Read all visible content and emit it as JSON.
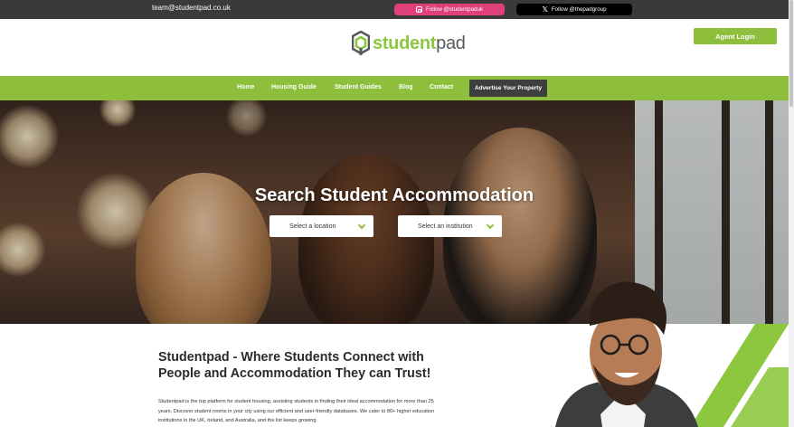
{
  "topbar": {
    "email": "team@studentpad.co.uk",
    "instagram": {
      "label": "Follow @studentpaduk",
      "icon": "instagram-icon",
      "color": "#e0407a"
    },
    "x": {
      "label": "Follow @thepadgroup",
      "icon": "x-icon",
      "color": "#000000"
    }
  },
  "header": {
    "logo": {
      "part1": "student",
      "part2": "pad"
    },
    "agent_login": "Agent Login"
  },
  "nav": {
    "items": [
      {
        "label": "Home"
      },
      {
        "label": "Housing Guide"
      },
      {
        "label": "Student Guides"
      },
      {
        "label": "Blog"
      },
      {
        "label": "Contact"
      }
    ],
    "advertise": "Advertise Your Property"
  },
  "hero": {
    "title": "Search Student Accommodation",
    "location_select": {
      "value": "Select a location"
    },
    "institution_select": {
      "value": "Select an institution"
    }
  },
  "intro": {
    "heading": "Studentpad - Where Students Connect with People and Accommodation They can Trust!",
    "body": "Studentpad is the top platform for student housing, assisting students in finding their ideal accommodation for more than 25 years. Discover student rooms in your city using our efficient and user-friendly databases. We cater to 80+ higher education institutions in the UK, Ireland, and Australia, and the list keeps growing."
  },
  "colors": {
    "brand_green": "#8dbf3c",
    "topbar": "#3a3a3a",
    "advertise_button": "#3d3f3e"
  }
}
